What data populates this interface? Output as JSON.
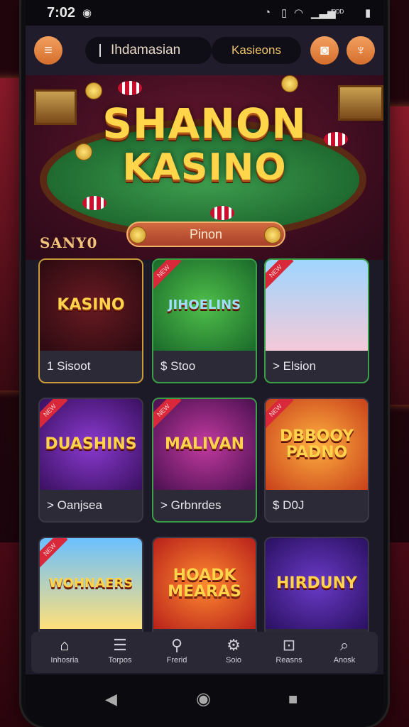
{
  "status_bar": {
    "time": "7:02",
    "battery_text": "ᴵᴰᴰᴰ"
  },
  "header": {
    "language": "Ihdamasian",
    "casino_tab": "Kasieons"
  },
  "hero": {
    "title_line1": "SHANON",
    "title_line2": "KASINO",
    "button_label": "Pinon"
  },
  "section_title": "SANY0",
  "games": [
    {
      "art_text": "KASINO",
      "label": "1 Sisoot",
      "ribbon": ""
    },
    {
      "art_text": "JIHOELINS",
      "label": "$ Stoo",
      "ribbon": "NEW"
    },
    {
      "art_text": "",
      "label": "> Elsion",
      "ribbon": "NEW"
    },
    {
      "art_text": "DUASHINS",
      "label": "> Oanjsea",
      "ribbon": "NEW"
    },
    {
      "art_text": "MALIVAN",
      "label": "> Grbnrdes",
      "ribbon": "NEW"
    },
    {
      "art_text": "DBBOOY PADNO",
      "label": "$ D0J",
      "ribbon": "NEW"
    },
    {
      "art_text": "WOHNAERS",
      "label": "",
      "ribbon": "NEW"
    },
    {
      "art_text": "HOADK MEARAS",
      "label": "",
      "ribbon": ""
    },
    {
      "art_text": "HIRDUNY",
      "label": "",
      "ribbon": ""
    }
  ],
  "bottom_nav": [
    {
      "label": "Inhosria",
      "icon": "home-icon",
      "glyph": "⌂"
    },
    {
      "label": "Torpos",
      "icon": "stack-icon",
      "glyph": "☰"
    },
    {
      "label": "Frerid",
      "icon": "search-icon",
      "glyph": "⚲"
    },
    {
      "label": "Soio",
      "icon": "gear-icon",
      "glyph": "⚙"
    },
    {
      "label": "Reasns",
      "icon": "folder-icon",
      "glyph": "⊡"
    },
    {
      "label": "Anosk",
      "icon": "magnifier-icon",
      "glyph": "⌕"
    }
  ],
  "colors": {
    "accent": "#e07a3a",
    "gold": "#ffd54a",
    "panel": "#2c2a36"
  }
}
